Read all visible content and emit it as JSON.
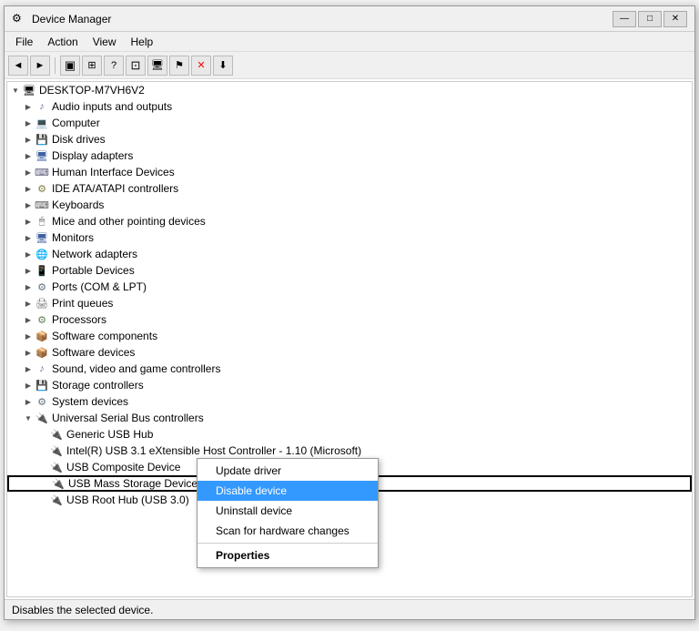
{
  "window": {
    "title": "Device Manager",
    "titleIcon": "⚙",
    "controls": {
      "minimize": "—",
      "maximize": "□",
      "close": "✕"
    }
  },
  "menubar": {
    "items": [
      "File",
      "Action",
      "View",
      "Help"
    ]
  },
  "toolbar": {
    "buttons": [
      "◄",
      "►",
      "▣",
      "◈",
      "?",
      "⊡",
      "🖥",
      "⚐",
      "✕",
      "⬇"
    ]
  },
  "tree": {
    "root": "DESKTOP-M7VH6V2",
    "items": [
      {
        "label": "Audio inputs and outputs",
        "indent": 1,
        "icon": "🔊",
        "hasArrow": true
      },
      {
        "label": "Computer",
        "indent": 1,
        "icon": "💻",
        "hasArrow": true
      },
      {
        "label": "Disk drives",
        "indent": 1,
        "icon": "💾",
        "hasArrow": true
      },
      {
        "label": "Display adapters",
        "indent": 1,
        "icon": "🖥",
        "hasArrow": true
      },
      {
        "label": "Human Interface Devices",
        "indent": 1,
        "icon": "⌨",
        "hasArrow": true
      },
      {
        "label": "IDE ATA/ATAPI controllers",
        "indent": 1,
        "icon": "🔌",
        "hasArrow": true
      },
      {
        "label": "Keyboards",
        "indent": 1,
        "icon": "⌨",
        "hasArrow": true
      },
      {
        "label": "Mice and other pointing devices",
        "indent": 1,
        "icon": "🖱",
        "hasArrow": true
      },
      {
        "label": "Monitors",
        "indent": 1,
        "icon": "🖥",
        "hasArrow": true
      },
      {
        "label": "Network adapters",
        "indent": 1,
        "icon": "🌐",
        "hasArrow": true
      },
      {
        "label": "Portable Devices",
        "indent": 1,
        "icon": "📱",
        "hasArrow": true
      },
      {
        "label": "Ports (COM & LPT)",
        "indent": 1,
        "icon": "🔌",
        "hasArrow": true
      },
      {
        "label": "Print queues",
        "indent": 1,
        "icon": "🖨",
        "hasArrow": true
      },
      {
        "label": "Processors",
        "indent": 1,
        "icon": "⚙",
        "hasArrow": true
      },
      {
        "label": "Software components",
        "indent": 1,
        "icon": "📦",
        "hasArrow": true
      },
      {
        "label": "Software devices",
        "indent": 1,
        "icon": "📦",
        "hasArrow": true
      },
      {
        "label": "Sound, video and game controllers",
        "indent": 1,
        "icon": "🔊",
        "hasArrow": true
      },
      {
        "label": "Storage controllers",
        "indent": 1,
        "icon": "💾",
        "hasArrow": true
      },
      {
        "label": "System devices",
        "indent": 1,
        "icon": "⚙",
        "hasArrow": true
      },
      {
        "label": "Universal Serial Bus controllers",
        "indent": 1,
        "icon": "🔌",
        "hasArrow": true,
        "expanded": true
      },
      {
        "label": "Generic USB Hub",
        "indent": 2,
        "icon": "🔌",
        "hasArrow": false
      },
      {
        "label": "Intel(R) USB 3.1 eXtensible Host Controller - 1.10 (Microsoft)",
        "indent": 2,
        "icon": "🔌",
        "hasArrow": false
      },
      {
        "label": "USB Composite Device",
        "indent": 2,
        "icon": "🔌",
        "hasArrow": false
      },
      {
        "label": "USB Mass Storage Device",
        "indent": 2,
        "icon": "🔌",
        "hasArrow": false,
        "selected": true
      },
      {
        "label": "USB Root Hub (USB 3.0)",
        "indent": 2,
        "icon": "🔌",
        "hasArrow": false
      }
    ]
  },
  "contextMenu": {
    "visible": true,
    "items": [
      {
        "label": "Update driver",
        "type": "normal"
      },
      {
        "label": "Disable device",
        "type": "active"
      },
      {
        "label": "Uninstall device",
        "type": "normal"
      },
      {
        "label": "Scan for hardware changes",
        "type": "normal"
      },
      {
        "type": "separator"
      },
      {
        "label": "Properties",
        "type": "bold"
      }
    ]
  },
  "statusBar": {
    "text": "Disables the selected device."
  }
}
